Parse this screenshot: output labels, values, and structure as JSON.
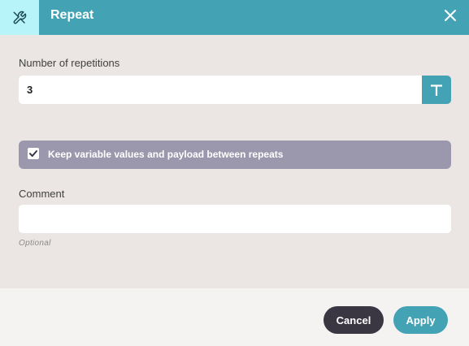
{
  "dialog": {
    "title": "Repeat",
    "header_icon": "wrench-screwdriver-icon",
    "close_icon": "close-icon"
  },
  "repetitions": {
    "label": "Number of repetitions",
    "value": "3",
    "type_button_glyph": "T"
  },
  "keep_values": {
    "label": "Keep variable values and payload between repeats",
    "checked": true
  },
  "comment": {
    "label": "Comment",
    "value": "",
    "hint": "Optional"
  },
  "footer": {
    "cancel_label": "Cancel",
    "apply_label": "Apply"
  },
  "colors": {
    "accent": "#43a3b4",
    "header_icon_bg": "#b7f4f9",
    "checkbox_row_bg": "#9b98ad",
    "cancel_bg": "#3a3743",
    "body_bg": "#ebe6e4",
    "footer_bg": "#f4f3f1"
  }
}
